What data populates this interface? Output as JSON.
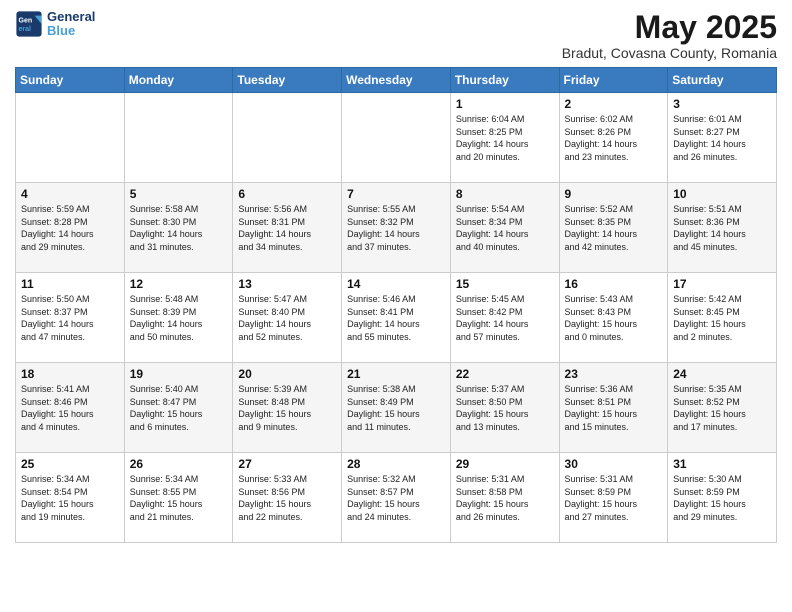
{
  "header": {
    "logo_line1": "General",
    "logo_line2": "Blue",
    "title": "May 2025",
    "subtitle": "Bradut, Covasna County, Romania"
  },
  "weekdays": [
    "Sunday",
    "Monday",
    "Tuesday",
    "Wednesday",
    "Thursday",
    "Friday",
    "Saturday"
  ],
  "weeks": [
    [
      {
        "day": "",
        "info": ""
      },
      {
        "day": "",
        "info": ""
      },
      {
        "day": "",
        "info": ""
      },
      {
        "day": "",
        "info": ""
      },
      {
        "day": "1",
        "info": "Sunrise: 6:04 AM\nSunset: 8:25 PM\nDaylight: 14 hours\nand 20 minutes."
      },
      {
        "day": "2",
        "info": "Sunrise: 6:02 AM\nSunset: 8:26 PM\nDaylight: 14 hours\nand 23 minutes."
      },
      {
        "day": "3",
        "info": "Sunrise: 6:01 AM\nSunset: 8:27 PM\nDaylight: 14 hours\nand 26 minutes."
      }
    ],
    [
      {
        "day": "4",
        "info": "Sunrise: 5:59 AM\nSunset: 8:28 PM\nDaylight: 14 hours\nand 29 minutes."
      },
      {
        "day": "5",
        "info": "Sunrise: 5:58 AM\nSunset: 8:30 PM\nDaylight: 14 hours\nand 31 minutes."
      },
      {
        "day": "6",
        "info": "Sunrise: 5:56 AM\nSunset: 8:31 PM\nDaylight: 14 hours\nand 34 minutes."
      },
      {
        "day": "7",
        "info": "Sunrise: 5:55 AM\nSunset: 8:32 PM\nDaylight: 14 hours\nand 37 minutes."
      },
      {
        "day": "8",
        "info": "Sunrise: 5:54 AM\nSunset: 8:34 PM\nDaylight: 14 hours\nand 40 minutes."
      },
      {
        "day": "9",
        "info": "Sunrise: 5:52 AM\nSunset: 8:35 PM\nDaylight: 14 hours\nand 42 minutes."
      },
      {
        "day": "10",
        "info": "Sunrise: 5:51 AM\nSunset: 8:36 PM\nDaylight: 14 hours\nand 45 minutes."
      }
    ],
    [
      {
        "day": "11",
        "info": "Sunrise: 5:50 AM\nSunset: 8:37 PM\nDaylight: 14 hours\nand 47 minutes."
      },
      {
        "day": "12",
        "info": "Sunrise: 5:48 AM\nSunset: 8:39 PM\nDaylight: 14 hours\nand 50 minutes."
      },
      {
        "day": "13",
        "info": "Sunrise: 5:47 AM\nSunset: 8:40 PM\nDaylight: 14 hours\nand 52 minutes."
      },
      {
        "day": "14",
        "info": "Sunrise: 5:46 AM\nSunset: 8:41 PM\nDaylight: 14 hours\nand 55 minutes."
      },
      {
        "day": "15",
        "info": "Sunrise: 5:45 AM\nSunset: 8:42 PM\nDaylight: 14 hours\nand 57 minutes."
      },
      {
        "day": "16",
        "info": "Sunrise: 5:43 AM\nSunset: 8:43 PM\nDaylight: 15 hours\nand 0 minutes."
      },
      {
        "day": "17",
        "info": "Sunrise: 5:42 AM\nSunset: 8:45 PM\nDaylight: 15 hours\nand 2 minutes."
      }
    ],
    [
      {
        "day": "18",
        "info": "Sunrise: 5:41 AM\nSunset: 8:46 PM\nDaylight: 15 hours\nand 4 minutes."
      },
      {
        "day": "19",
        "info": "Sunrise: 5:40 AM\nSunset: 8:47 PM\nDaylight: 15 hours\nand 6 minutes."
      },
      {
        "day": "20",
        "info": "Sunrise: 5:39 AM\nSunset: 8:48 PM\nDaylight: 15 hours\nand 9 minutes."
      },
      {
        "day": "21",
        "info": "Sunrise: 5:38 AM\nSunset: 8:49 PM\nDaylight: 15 hours\nand 11 minutes."
      },
      {
        "day": "22",
        "info": "Sunrise: 5:37 AM\nSunset: 8:50 PM\nDaylight: 15 hours\nand 13 minutes."
      },
      {
        "day": "23",
        "info": "Sunrise: 5:36 AM\nSunset: 8:51 PM\nDaylight: 15 hours\nand 15 minutes."
      },
      {
        "day": "24",
        "info": "Sunrise: 5:35 AM\nSunset: 8:52 PM\nDaylight: 15 hours\nand 17 minutes."
      }
    ],
    [
      {
        "day": "25",
        "info": "Sunrise: 5:34 AM\nSunset: 8:54 PM\nDaylight: 15 hours\nand 19 minutes."
      },
      {
        "day": "26",
        "info": "Sunrise: 5:34 AM\nSunset: 8:55 PM\nDaylight: 15 hours\nand 21 minutes."
      },
      {
        "day": "27",
        "info": "Sunrise: 5:33 AM\nSunset: 8:56 PM\nDaylight: 15 hours\nand 22 minutes."
      },
      {
        "day": "28",
        "info": "Sunrise: 5:32 AM\nSunset: 8:57 PM\nDaylight: 15 hours\nand 24 minutes."
      },
      {
        "day": "29",
        "info": "Sunrise: 5:31 AM\nSunset: 8:58 PM\nDaylight: 15 hours\nand 26 minutes."
      },
      {
        "day": "30",
        "info": "Sunrise: 5:31 AM\nSunset: 8:59 PM\nDaylight: 15 hours\nand 27 minutes."
      },
      {
        "day": "31",
        "info": "Sunrise: 5:30 AM\nSunset: 8:59 PM\nDaylight: 15 hours\nand 29 minutes."
      }
    ]
  ]
}
